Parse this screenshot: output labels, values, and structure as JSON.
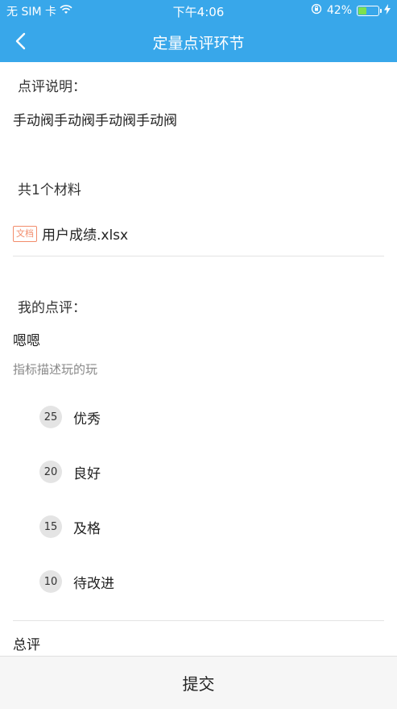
{
  "status_bar": {
    "carrier": "无 SIM 卡",
    "time": "下午4:06",
    "battery": "42%",
    "battery_level": 0.42
  },
  "nav": {
    "title": "定量点评环节"
  },
  "description": {
    "label": "点评说明：",
    "text": "手动阀手动阀手动阀手动阀"
  },
  "materials": {
    "label": "共1个材料",
    "file_badge": "文档",
    "file_name": "用户成绩.xlsx"
  },
  "my_review": {
    "label": "我的点评：",
    "value": "嗯嗯",
    "indicator": "指标描述玩的玩",
    "options": [
      {
        "score": "25",
        "label": "优秀"
      },
      {
        "score": "20",
        "label": "良好"
      },
      {
        "score": "15",
        "label": "及格"
      },
      {
        "score": "10",
        "label": "待改进"
      }
    ]
  },
  "summary": {
    "label": "总评"
  },
  "footer": {
    "submit_label": "提交"
  }
}
